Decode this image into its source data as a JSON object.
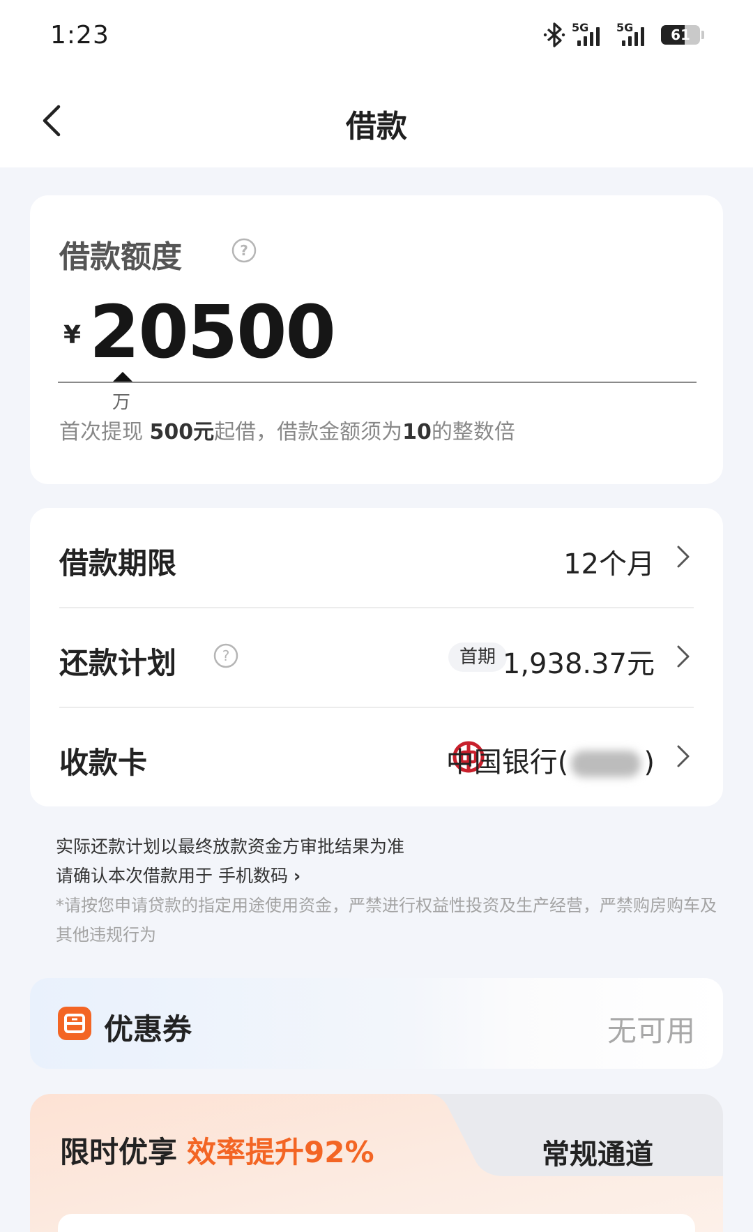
{
  "status_bar": {
    "time": "1:23",
    "network_1": "5G",
    "network_2": "5G",
    "battery": "61",
    "battery_level": 0.61
  },
  "nav": {
    "title": "借款",
    "back_icon": "chevron-left-icon"
  },
  "amount_card": {
    "label": "借款额度",
    "currency_symbol": "¥",
    "amount": "20500",
    "unit_marker": "万",
    "hint_prefix": "首次提现 ",
    "hint_min": "500元",
    "hint_middle": "起借，借款金额须为",
    "hint_multiple": "10",
    "hint_suffix": "的整数倍"
  },
  "details": {
    "term_label": "借款期限",
    "term_value": "12个月",
    "plan_label": "还款计划",
    "plan_tag": "首期",
    "plan_value": "1,938.37元",
    "card_label": "收款卡",
    "card_bank_prefix": "中国银行(",
    "card_bank_suffix": ")",
    "bank_icon": "bank-of-china-icon"
  },
  "notice": {
    "line1": "实际还款计划以最终放款资金方审批结果为准",
    "line2": "请确认本次借款用于 手机数码",
    "line2_arrow": "›",
    "line3": "*请按您申请贷款的指定用途使用资金，严禁进行权益性投资及生产经营，严禁购房购车及其他违规行为"
  },
  "coupon": {
    "label": "优惠券",
    "status": "无可用",
    "icon": "coupon-icon"
  },
  "promo": {
    "limited_label": "限时优享",
    "limited_highlight": "效率提升92%",
    "regular_label": "常规通道"
  },
  "colors": {
    "accent": "#f36524",
    "background": "#f3f5fa",
    "text_primary": "#222222",
    "text_secondary": "#888888"
  }
}
